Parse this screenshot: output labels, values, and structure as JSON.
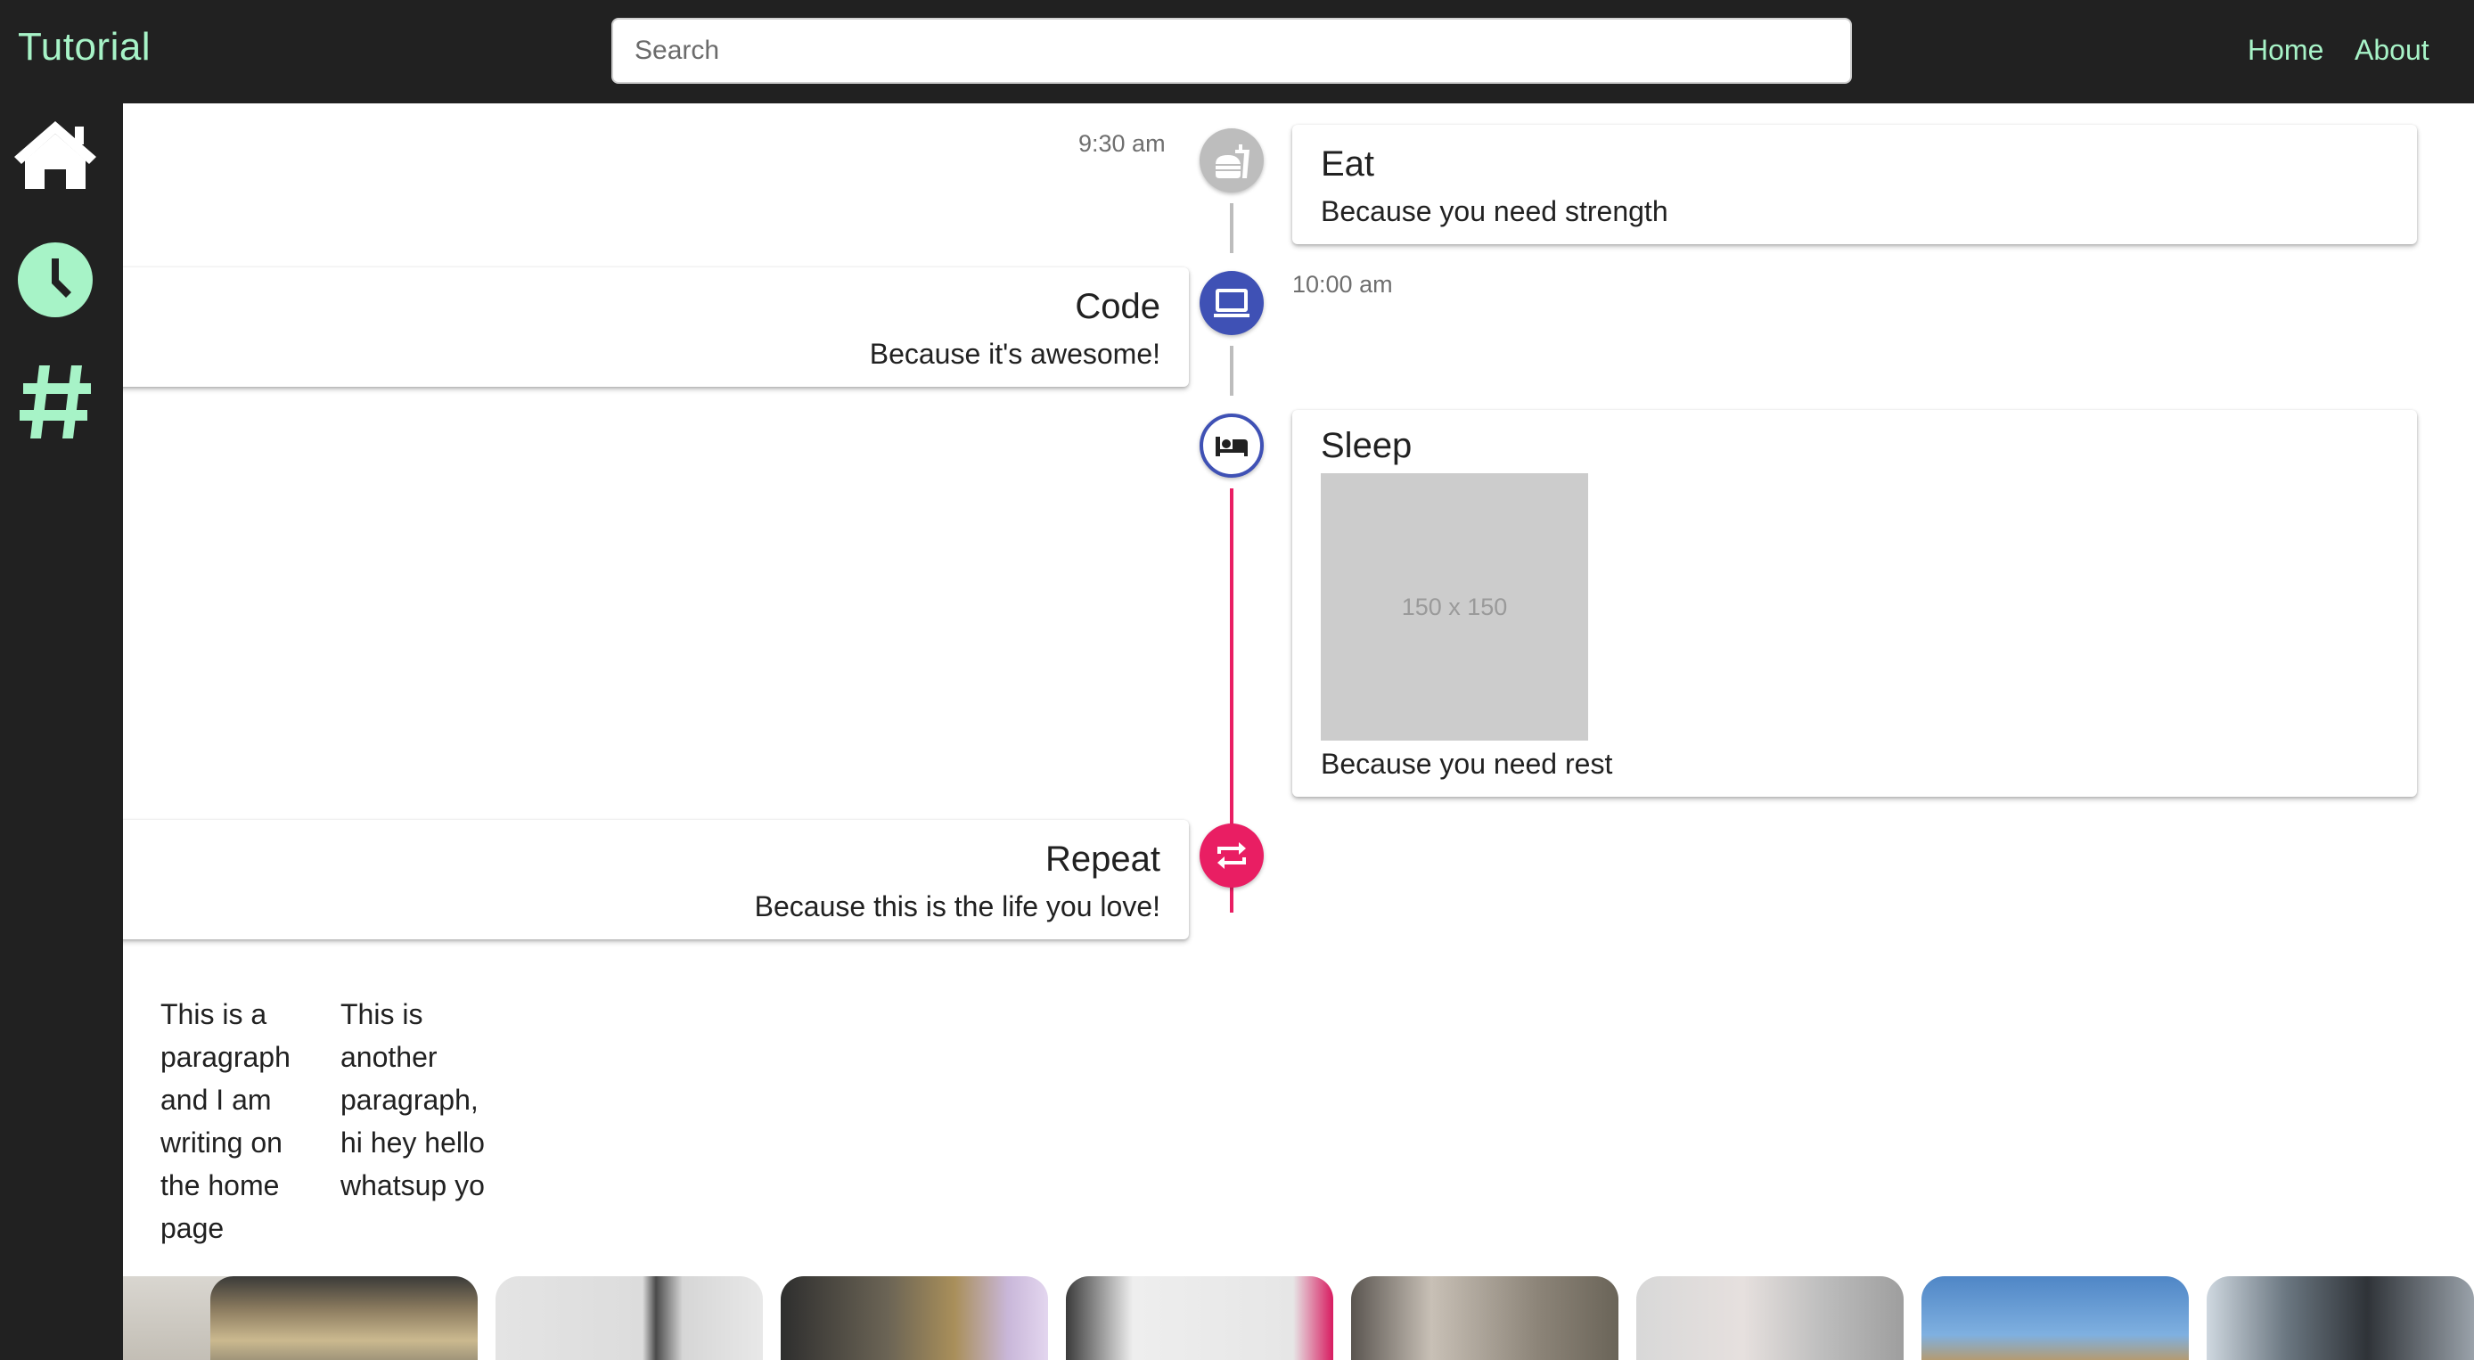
{
  "app": {
    "brand": "Tutorial"
  },
  "header": {
    "search_placeholder": "Search",
    "nav": [
      "Home",
      "About"
    ]
  },
  "sidebar": {
    "items": [
      {
        "icon": "home-icon"
      },
      {
        "icon": "clock-icon"
      },
      {
        "icon": "hashtag-icon"
      }
    ]
  },
  "timeline": [
    {
      "time": "9:30 am",
      "title": "Eat",
      "body": "Because you need strength",
      "icon": "fastfood-icon",
      "dot_color": "#bdbdbd"
    },
    {
      "time": "10:00 am",
      "title": "Code",
      "body": "Because it's awesome!",
      "icon": "laptop-icon",
      "dot_color": "#3f51b5"
    },
    {
      "title": "Sleep",
      "image_placeholder": "150 x 150",
      "body": "Because you need rest",
      "icon": "hotel-icon",
      "dot_color": "#3f51b5"
    },
    {
      "title": "Repeat",
      "body": "Because this is the life you love!",
      "icon": "repeat-icon",
      "dot_color": "#e91e63"
    }
  ],
  "paragraphs": [
    [
      "This is a",
      "paragraph",
      "and I am",
      "writing on",
      "the home",
      "page"
    ],
    [
      "This is",
      "another",
      "paragraph,",
      "hi hey hello",
      "whatsup yo"
    ]
  ],
  "colors": {
    "bar_bg": "#212121",
    "accent": "#a7f3c7",
    "primary": "#3f51b5",
    "secondary": "#e91e63",
    "grey_connector": "#bdbdbd"
  },
  "gallery": {
    "thumbnail_count": 9
  }
}
